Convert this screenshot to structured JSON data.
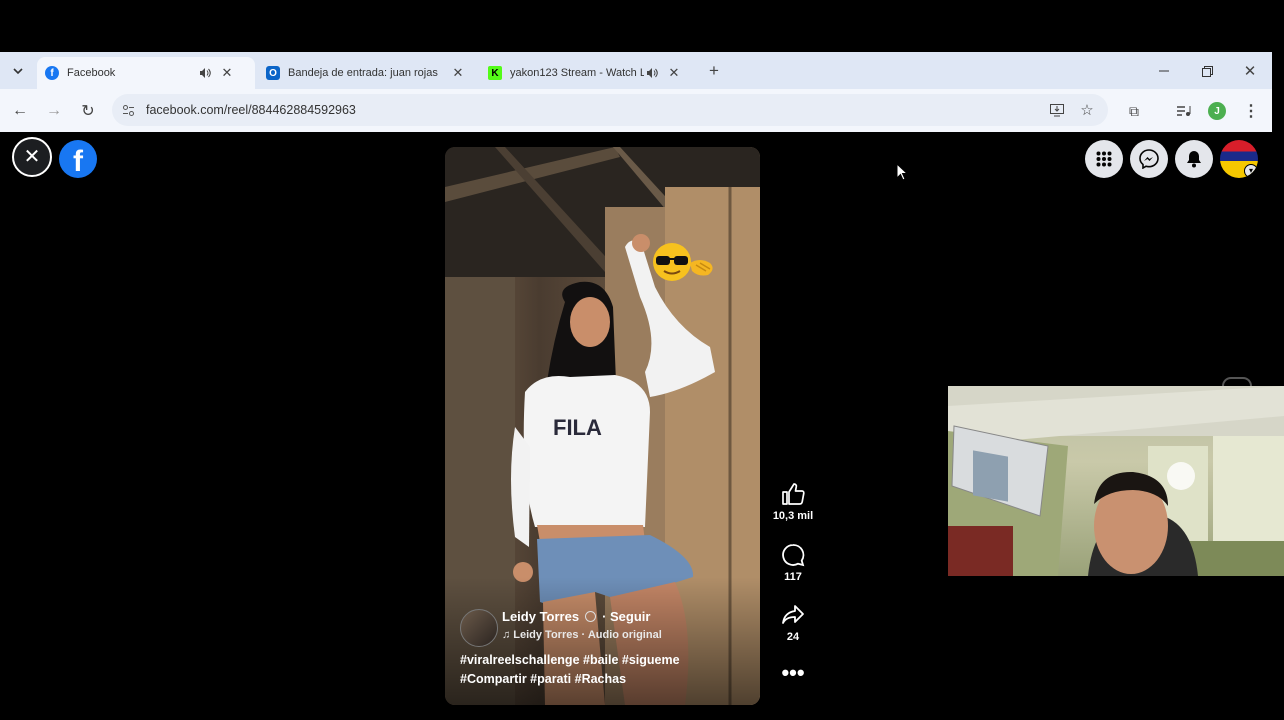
{
  "browser": {
    "tabs": [
      {
        "label": "Facebook",
        "favicon": "facebook-icon",
        "audio": true,
        "active": true
      },
      {
        "label": "Bandeja de entrada: juan rojas",
        "favicon": "outlook-icon",
        "audio": false,
        "active": false
      },
      {
        "label": "yakon123 Stream - Watch L",
        "favicon": "kick-icon",
        "audio": true,
        "active": false
      }
    ],
    "url": "facebook.com/reel/884462884592963",
    "profile_initial": "J"
  },
  "reel": {
    "author": "Leidy Torres",
    "follow_label": "· Seguir",
    "audio_line": "Leidy Torres · Audio original",
    "caption_line1": "#viralreelschallenge #baile #sigueme",
    "caption_line2": "#Compartir #parati #Rachas",
    "likes": "10,3 mil",
    "comments": "117",
    "shares": "24",
    "sticker": "sunglasses-emoji"
  },
  "colors": {
    "facebook_blue": "#1877f2",
    "tab_strip": "#dfe7f5",
    "omnibox": "#e8edf6",
    "profile_green": "#4caf50"
  }
}
